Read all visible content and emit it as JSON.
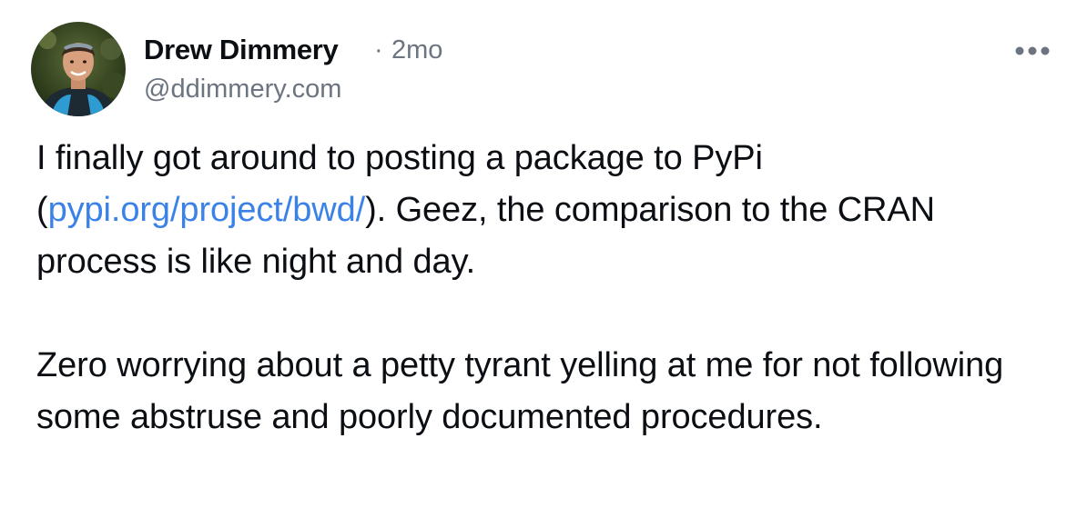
{
  "post": {
    "author": {
      "display_name": "Drew Dimmery",
      "handle": "@ddimmery.com",
      "avatar_icon": "user-avatar-photo"
    },
    "separator": "·",
    "timestamp": "2mo",
    "more_icon": "ellipsis-icon",
    "body": {
      "paragraph1": {
        "before_link": "I finally got around to posting a package to PyPi (",
        "link_text": "pypi.org/project/bwd/",
        "after_link": "). Geez, the comparison to the CRAN process is like night and day."
      },
      "paragraph2": "Zero worrying about a petty tyrant yelling at me for not following some abstruse and poorly documented procedures."
    }
  },
  "colors": {
    "text": "#0b0f14",
    "muted": "#6b7480",
    "link": "#3b82e8",
    "background": "#ffffff"
  }
}
